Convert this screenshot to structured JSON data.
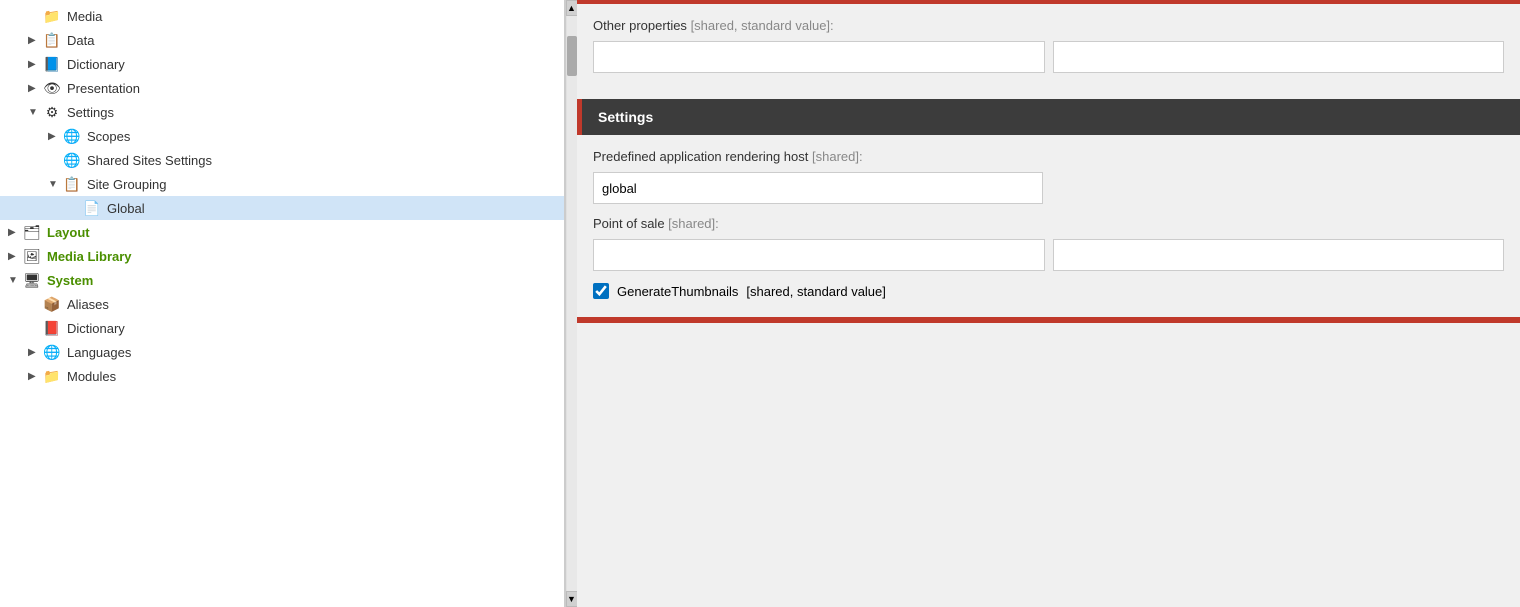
{
  "sidebar": {
    "items": [
      {
        "id": "media",
        "label": "Media",
        "level": 1,
        "arrow": "",
        "icon": "📁",
        "iconColor": "#e6a020",
        "selected": false
      },
      {
        "id": "data",
        "label": "Data",
        "level": 1,
        "arrow": "▶",
        "icon": "📋",
        "iconColor": "#e6a020",
        "selected": false
      },
      {
        "id": "dictionary",
        "label": "Dictionary",
        "level": 1,
        "arrow": "▶",
        "icon": "📘",
        "iconColor": "#3a6abf",
        "selected": false
      },
      {
        "id": "presentation",
        "label": "Presentation",
        "level": 1,
        "arrow": "▶",
        "icon": "👁",
        "iconColor": "#3a6abf",
        "selected": false
      },
      {
        "id": "settings",
        "label": "Settings",
        "level": 1,
        "arrow": "▼",
        "icon": "⚙",
        "iconColor": "#777",
        "selected": false
      },
      {
        "id": "scopes",
        "label": "Scopes",
        "level": 2,
        "arrow": "▶",
        "icon": "🌐",
        "iconColor": "#777",
        "selected": false
      },
      {
        "id": "shared-sites-settings",
        "label": "Shared Sites Settings",
        "level": 2,
        "arrow": "",
        "icon": "🌐",
        "iconColor": "#3a6abf",
        "selected": false
      },
      {
        "id": "site-grouping",
        "label": "Site Grouping",
        "level": 2,
        "arrow": "▼",
        "icon": "📋",
        "iconColor": "#555",
        "selected": false
      },
      {
        "id": "global",
        "label": "Global",
        "level": 3,
        "arrow": "",
        "icon": "📄",
        "iconColor": "#3a6abf",
        "selected": true
      },
      {
        "id": "layout",
        "label": "Layout",
        "level": 0,
        "arrow": "▶",
        "icon": "🗂",
        "iconColor": "#3a6abf",
        "labelClass": "label-green",
        "selected": false
      },
      {
        "id": "media-library",
        "label": "Media Library",
        "level": 0,
        "arrow": "▶",
        "icon": "🖼",
        "iconColor": "#3a6abf",
        "labelClass": "label-green",
        "selected": false
      },
      {
        "id": "system",
        "label": "System",
        "level": 0,
        "arrow": "▼",
        "icon": "🖥",
        "iconColor": "#3a6abf",
        "labelClass": "label-green",
        "selected": false
      },
      {
        "id": "aliases",
        "label": "Aliases",
        "level": 1,
        "arrow": "",
        "icon": "📦",
        "iconColor": "#e6a020",
        "selected": false
      },
      {
        "id": "dictionary2",
        "label": "Dictionary",
        "level": 1,
        "arrow": "",
        "icon": "📕",
        "iconColor": "#c0392b",
        "selected": false
      },
      {
        "id": "languages",
        "label": "Languages",
        "level": 1,
        "arrow": "▶",
        "icon": "🌐",
        "iconColor": "#3a6abf",
        "selected": false
      },
      {
        "id": "modules",
        "label": "Modules",
        "level": 1,
        "arrow": "▶",
        "icon": "📁",
        "iconColor": "#e6a020",
        "selected": false
      }
    ]
  },
  "main": {
    "other_properties_label": "Other properties",
    "other_properties_meta": "[shared, standard value]:",
    "settings_header": "Settings",
    "predefined_host_label": "Predefined application rendering host",
    "predefined_host_meta": "[shared]:",
    "predefined_host_value": "global",
    "point_of_sale_label": "Point of sale",
    "point_of_sale_meta": "[shared]:",
    "generate_thumbnails_label": "GenerateThumbnails",
    "generate_thumbnails_meta": "[shared, standard value]",
    "generate_thumbnails_checked": true
  }
}
